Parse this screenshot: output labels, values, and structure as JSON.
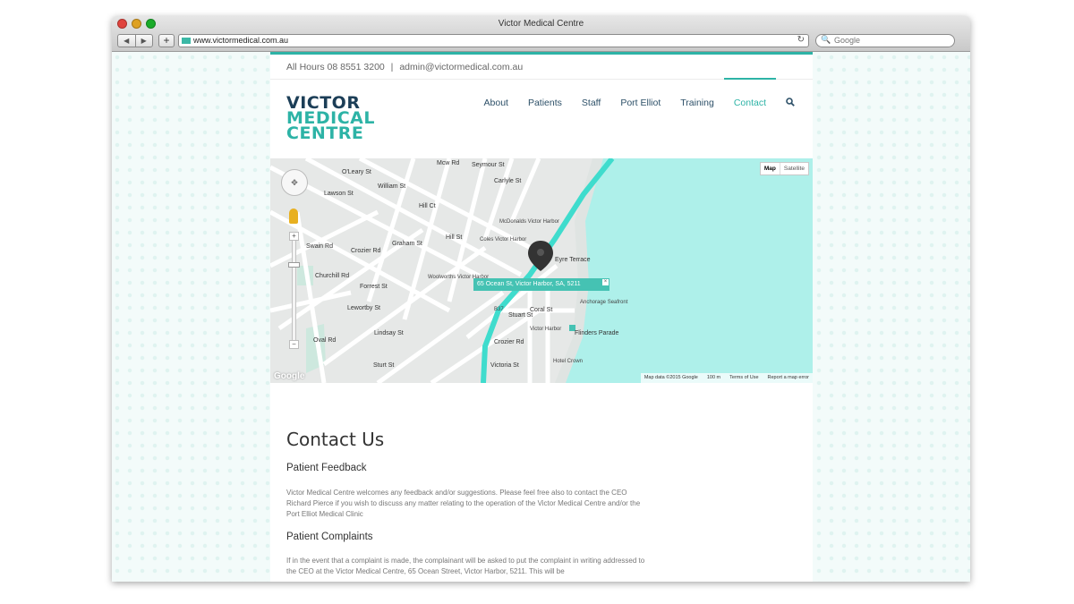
{
  "browser": {
    "window_title": "Victor Medical Centre",
    "url": "www.victormedical.com.au",
    "search_placeholder": "Google",
    "back_glyph": "◀",
    "forward_glyph": "▶",
    "plus_glyph": "+",
    "reload_glyph": "↻",
    "search_glyph": "🔍"
  },
  "header": {
    "hours_text": "All Hours 08 8551 3200",
    "separator": "|",
    "email": "admin@victormedical.com.au"
  },
  "logo": {
    "line1": "VICTOR",
    "line2": "MEDICAL",
    "line3": "CENTRE"
  },
  "nav": {
    "items": [
      {
        "label": "About"
      },
      {
        "label": "Patients"
      },
      {
        "label": "Staff"
      },
      {
        "label": "Port Elliot"
      },
      {
        "label": "Training"
      },
      {
        "label": "Contact"
      }
    ],
    "active_index": 5,
    "search_icon": "search-icon"
  },
  "map": {
    "map_button": "Map",
    "satellite_button": "Satellite",
    "info_window": "65 Ocean St, Victor Harbor, SA, 5211",
    "close_glyph": "×",
    "zoom_in": "+",
    "zoom_out": "−",
    "pan_glyph": "✥",
    "footer_data": "Map data ©2015 Google",
    "footer_scale": "100 m",
    "footer_terms": "Terms of Use",
    "footer_report": "Report a map error",
    "google_logo": "Google",
    "roads": [
      "O'Leary St",
      "Lawson St",
      "William St",
      "Hill Ct",
      "Hill St",
      "Graham St",
      "Crozier Rd",
      "Swain Rd",
      "Churchill Rd",
      "Forrest St",
      "Lewortby St",
      "Lindsay St",
      "Oval Rd",
      "Sturt St",
      "Eyre Terrace",
      "Coral St",
      "Stuart St",
      "Crozier Rd",
      "Victoria St",
      "Flinders Parade",
      "Carlyle St",
      "Seymour St",
      "Mcw Rd"
    ],
    "pois": [
      "McDonalds Victor Harbor",
      "Coles Victor Harbor",
      "Woolworths Victor Harbor",
      "Anchorage Seafront",
      "Victor Harbor",
      "Hotel Crown",
      "B37"
    ],
    "colors": {
      "water": "#aef0ea",
      "land": "#e6e8e7",
      "road": "#ffffff",
      "highway": "#3fdccd",
      "marker": "#333333"
    }
  },
  "content": {
    "title": "Contact Us",
    "feedback_heading": "Patient Feedback",
    "feedback_text": "Victor Medical Centre welcomes any feedback and/or suggestions.  Please feel free also to contact the CEO Richard Pierce if you wish to discuss any matter relating to the operation of the Victor Medical Centre and/or the Port Elliot Medical Clinic",
    "complaints_heading": "Patient Complaints",
    "complaints_text": "If in the event that a complaint is made, the complainant will be asked to put the complaint in writing addressed to the CEO at the Victor Medical Centre, 65 Ocean Street, Victor Harbor, 5211. This will be"
  },
  "theme": {
    "accent": "#2db3a6",
    "navy": "#1c3e57"
  }
}
